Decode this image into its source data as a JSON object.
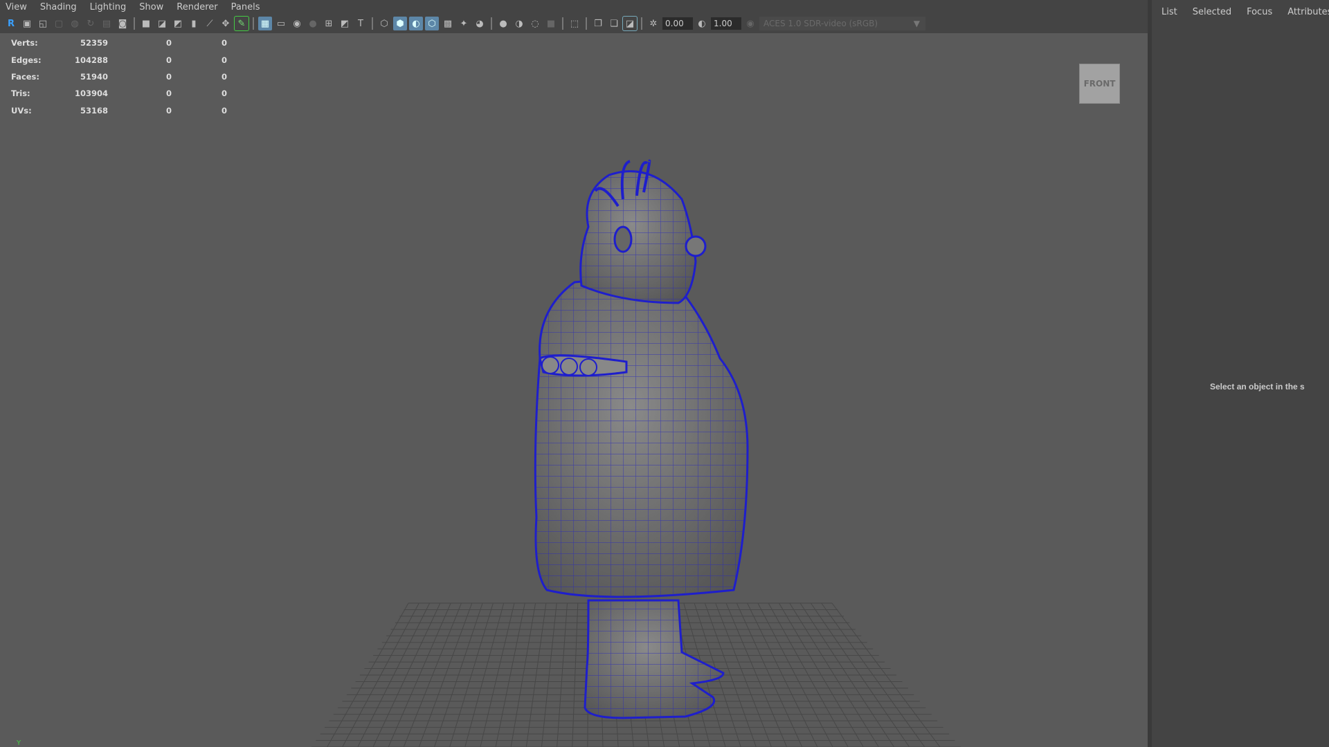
{
  "menu": [
    "View",
    "Shading",
    "Lighting",
    "Show",
    "Renderer",
    "Panels"
  ],
  "toolbar": {
    "icons": [
      {
        "name": "select-camera-icon",
        "glyph": "R",
        "state": "active-blue"
      },
      {
        "name": "lock-camera-icon",
        "glyph": "▣"
      },
      {
        "name": "camera-attributes-icon",
        "glyph": "◱"
      },
      {
        "name": "bookmark-icon",
        "glyph": "▢",
        "state": "dim"
      },
      {
        "name": "image-plane-icon",
        "glyph": "◍",
        "state": "dim"
      },
      {
        "name": "refresh-icon",
        "glyph": "↻",
        "state": "dim"
      },
      {
        "name": "grease-pencil-icon",
        "glyph": "▤",
        "state": "dim"
      },
      {
        "name": "snapshot-icon",
        "glyph": "◙"
      },
      {
        "sep": true
      },
      {
        "name": "camera-icon",
        "glyph": "■"
      },
      {
        "name": "lock-camera-icon-2",
        "glyph": "◪"
      },
      {
        "name": "camera-settings-icon",
        "glyph": "◩"
      },
      {
        "name": "bookmark-flag-icon",
        "glyph": "▮"
      },
      {
        "name": "2d-pan-zoom-icon",
        "glyph": "⟋"
      },
      {
        "name": "pan-zoom-icon",
        "glyph": "✥"
      },
      {
        "name": "grease-pencil-tool-icon",
        "glyph": "✎",
        "state": "green"
      },
      {
        "sep": true
      },
      {
        "name": "grid-icon",
        "glyph": "▦",
        "state": "on"
      },
      {
        "name": "film-gate-icon",
        "glyph": "▭"
      },
      {
        "name": "resolution-gate-icon",
        "glyph": "◉"
      },
      {
        "name": "gate-mask-icon",
        "glyph": "●",
        "state": "dim"
      },
      {
        "name": "field-chart-icon",
        "glyph": "⊞"
      },
      {
        "name": "safe-action-icon",
        "glyph": "◩"
      },
      {
        "name": "safe-title-icon",
        "glyph": "T"
      },
      {
        "sep": true
      },
      {
        "name": "wireframe-icon",
        "glyph": "⬡"
      },
      {
        "name": "smooth-shade-icon",
        "glyph": "⬢",
        "state": "on"
      },
      {
        "name": "default-material-icon",
        "glyph": "◐",
        "state": "on"
      },
      {
        "name": "wireframe-on-shaded-icon",
        "glyph": "⬡",
        "state": "on"
      },
      {
        "name": "textured-icon",
        "glyph": "▩"
      },
      {
        "name": "lights-icon",
        "glyph": "✦"
      },
      {
        "name": "shadows-icon",
        "glyph": "◕"
      },
      {
        "sep": true
      },
      {
        "name": "ambient-occlusion-icon",
        "glyph": "●"
      },
      {
        "name": "motion-blur-icon",
        "glyph": "◑"
      },
      {
        "name": "anti-aliasing-icon",
        "glyph": "◌"
      },
      {
        "name": "depth-of-field-icon",
        "glyph": "■",
        "state": "dim"
      },
      {
        "sep": true
      },
      {
        "name": "isolate-select-icon",
        "glyph": "⬚"
      },
      {
        "sep": true
      },
      {
        "name": "xray-icon",
        "glyph": "❐"
      },
      {
        "name": "xray-joints-icon",
        "glyph": "❏"
      },
      {
        "name": "xray-active-components-icon",
        "glyph": "◪",
        "state": "outline"
      },
      {
        "sep": true
      },
      {
        "name": "exposure-icon",
        "glyph": "✲"
      }
    ],
    "exposure": "0.00",
    "gamma_icon": "gamma-icon",
    "gamma": "1.00",
    "color_space": "ACES 1.0 SDR-video (sRGB)"
  },
  "stats": [
    {
      "label": "Verts:",
      "value": "52359",
      "a": "0",
      "b": "0"
    },
    {
      "label": "Edges:",
      "value": "104288",
      "a": "0",
      "b": "0"
    },
    {
      "label": "Faces:",
      "value": "51940",
      "a": "0",
      "b": "0"
    },
    {
      "label": "Tris:",
      "value": "103904",
      "a": "0",
      "b": "0"
    },
    {
      "label": "UVs:",
      "value": "53168",
      "a": "0",
      "b": "0"
    }
  ],
  "viewcube": "FRONT",
  "axis_label": "Y",
  "right_panel": {
    "tabs": [
      "List",
      "Selected",
      "Focus",
      "Attributes"
    ],
    "hint": "Select an object in the s"
  },
  "colors": {
    "wire": "#1e1ecc",
    "accent": "#5d87a8"
  }
}
